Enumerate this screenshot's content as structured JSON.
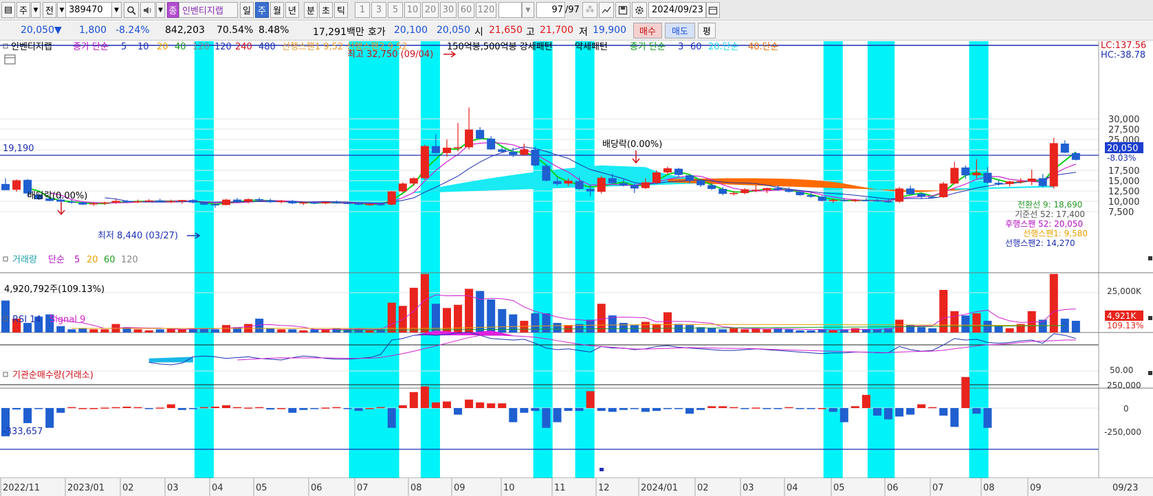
{
  "toolbar": {
    "period_selector": "주",
    "prev_label": "전",
    "code": "389470",
    "stock_name": "인벤티지랩",
    "tf_items": [
      "일",
      "주",
      "월",
      "년",
      "분",
      "초",
      "틱"
    ],
    "tf_selected": "주",
    "count_items": [
      "1",
      "3",
      "5",
      "10",
      "20",
      "30",
      "60",
      "120"
    ],
    "count_value": "97",
    "count_total": "/97",
    "date": "2024/09/23"
  },
  "quote": {
    "price": "20,050",
    "change_arrow": "▼",
    "change": "1,800",
    "change_pct": "-8.24%",
    "volume": "842,203",
    "volume_ratio": "70.54%",
    "turnover": "8.48%",
    "amount": "17,291백만",
    "hoga_label": "호가",
    "ask": "20,100",
    "bid": "20,050",
    "open_label": "시",
    "open": "21,650",
    "high_label": "고",
    "high": "21,700",
    "low_label": "저",
    "low": "19,900",
    "buy_label": "매수",
    "sell_label": "매도",
    "pyeong_label": "평"
  },
  "legend": {
    "name": "인벤티지랩",
    "price_ma_label": "종가 단순",
    "price_ma": [
      "5",
      "10",
      "20",
      "40",
      "120",
      "120",
      "240",
      "480"
    ],
    "ichimoku": "선행스팬1 9,52 선행스팬2 9,52",
    "pattern1": "150억봉,500억봉 강세패턴",
    "pattern2": "약세패턴",
    "ma2_label": "종가 단순",
    "ma2": [
      "3",
      "60",
      "20.단순",
      "40.단순"
    ]
  },
  "annotations": {
    "high": "최고 32,750 (09/04)",
    "low": "최저 8,440 (03/27)",
    "div1": "배당락(0.00%)",
    "div2": "배당락(0.00%)",
    "hline": "19,190"
  },
  "right_labels": {
    "lc": "LC:137.56",
    "hc": "HC:-38.78",
    "last": "20,050",
    "last_pct": "-8.03%",
    "ichi1": "전환선 9: 18,690",
    "ichi2": "기준선 52: 17,400",
    "ichi3": "후행스팬 52: 20,050",
    "ichi4": "선행스팬1: 9,580",
    "ichi5": "선행스팬2: 14,270",
    "price_ticks": [
      "30,000",
      "27,500",
      "25,000",
      "22,500",
      "17,500",
      "15,000",
      "12,500",
      "10,000",
      "7,500"
    ],
    "vol_tick": "25,000K",
    "vol_last": "4,921K",
    "vol_last_pct": "109.13%",
    "rsi_tick": "50.00",
    "inst_ticks": [
      "250,000",
      "0",
      "-250,000"
    ]
  },
  "volume_panel": {
    "label": "거래량",
    "ma_label": "단순",
    "ma": [
      "5",
      "20",
      "60",
      "120"
    ],
    "value": "4,920,792주(109.13%)"
  },
  "rsi_panel": {
    "label": "RSI 14",
    "signal": "Signal 9"
  },
  "inst_panel": {
    "label": "기관순매수량(거래소)",
    "value": "-333,657"
  },
  "xaxis": [
    "2022/11",
    "2023/01",
    "02",
    "03",
    "04",
    "05",
    "06",
    "07",
    "08",
    "09",
    "10",
    "11",
    "12",
    "2024/01",
    "02",
    "03",
    "04",
    "05",
    "06",
    "07",
    "08",
    "09"
  ],
  "xaxis_right": "09/23",
  "colors": {
    "up": "#e8241d",
    "down": "#1f5fd0",
    "highlight": "#00f3f8",
    "cloud_bull": "#19eaf3",
    "cloud_bear": "#ff6a00"
  },
  "chart_data": {
    "type": "candlestick",
    "candles": [
      [
        14200,
        15600,
        13000,
        12700
      ],
      [
        12800,
        15300,
        12300,
        15100
      ],
      [
        15200,
        15400,
        11100,
        11900
      ],
      [
        11600,
        12000,
        10300,
        10500
      ],
      [
        10700,
        11100,
        10000,
        10100
      ],
      [
        10400,
        11300,
        9800,
        9900
      ],
      [
        9900,
        10400,
        9400,
        9700
      ],
      [
        9700,
        10000,
        9100,
        9200
      ],
      [
        9300,
        9800,
        8900,
        9500
      ],
      [
        9500,
        9900,
        9100,
        9700
      ],
      [
        9700,
        10500,
        9400,
        10100
      ],
      [
        10100,
        10300,
        9600,
        9800
      ],
      [
        9800,
        10400,
        9600,
        10000
      ],
      [
        10000,
        10500,
        9800,
        10200
      ],
      [
        10200,
        10600,
        9800,
        9900
      ],
      [
        9900,
        10400,
        9600,
        10000
      ],
      [
        10000,
        10300,
        9400,
        10300
      ],
      [
        10300,
        10500,
        9500,
        9700
      ],
      [
        9700,
        9900,
        9000,
        9200
      ],
      [
        9300,
        9500,
        8440,
        9000
      ],
      [
        9100,
        10600,
        9000,
        10400
      ],
      [
        10400,
        10800,
        9700,
        9900
      ],
      [
        9900,
        10700,
        9500,
        10500
      ],
      [
        10500,
        10900,
        10000,
        10200
      ],
      [
        10200,
        10600,
        9600,
        9800
      ],
      [
        9800,
        10300,
        9500,
        10100
      ],
      [
        10100,
        10300,
        9300,
        9500
      ],
      [
        9500,
        9900,
        9100,
        9700
      ],
      [
        9700,
        9900,
        9300,
        9500
      ],
      [
        9500,
        10000,
        9300,
        9800
      ],
      [
        9800,
        10200,
        9400,
        9600
      ],
      [
        9600,
        9900,
        9300,
        9500
      ],
      [
        9500,
        9700,
        9000,
        9200
      ],
      [
        9200,
        9500,
        8900,
        9300
      ],
      [
        9300,
        9500,
        8900,
        9100
      ],
      [
        9200,
        12500,
        9000,
        12400
      ],
      [
        12400,
        14600,
        12100,
        14300
      ],
      [
        14300,
        15800,
        13700,
        15600
      ],
      [
        15600,
        23700,
        15300,
        23400
      ],
      [
        23400,
        26200,
        21600,
        21700
      ],
      [
        21700,
        25000,
        20800,
        23000
      ],
      [
        23000,
        29000,
        22100,
        23100
      ],
      [
        23100,
        32750,
        22600,
        27400
      ],
      [
        27300,
        28000,
        25000,
        25200
      ],
      [
        25200,
        25800,
        22500,
        22600
      ],
      [
        22600,
        23100,
        21800,
        22000
      ],
      [
        22000,
        23000,
        20700,
        21300
      ],
      [
        21300,
        24000,
        21000,
        22600
      ],
      [
        22500,
        23200,
        18500,
        18700
      ],
      [
        18600,
        19000,
        14800,
        15000
      ],
      [
        14900,
        15900,
        13800,
        14200
      ],
      [
        14300,
        15600,
        13700,
        15000
      ],
      [
        14900,
        15900,
        12800,
        13000
      ],
      [
        13000,
        14000,
        11200,
        12400
      ],
      [
        12300,
        16200,
        11900,
        15700
      ],
      [
        15600,
        16700,
        14200,
        14400
      ],
      [
        14400,
        15300,
        13600,
        13900
      ],
      [
        13900,
        14300,
        12000,
        13100
      ],
      [
        13200,
        15600,
        13000,
        14600
      ],
      [
        14500,
        17500,
        14200,
        17000
      ],
      [
        17000,
        18400,
        16600,
        18000
      ],
      [
        17900,
        18100,
        15900,
        16400
      ],
      [
        16300,
        16500,
        14400,
        15000
      ],
      [
        15000,
        15300,
        13500,
        13900
      ],
      [
        13900,
        14400,
        12700,
        13000
      ],
      [
        13000,
        13500,
        11500,
        11800
      ],
      [
        11800,
        12500,
        11400,
        12000
      ],
      [
        12000,
        13200,
        11700,
        12900
      ],
      [
        12800,
        13800,
        12200,
        12800
      ],
      [
        12700,
        13300,
        12000,
        13200
      ],
      [
        13200,
        13900,
        12500,
        12800
      ],
      [
        12800,
        13400,
        12100,
        12300
      ],
      [
        12300,
        12800,
        11300,
        11500
      ],
      [
        11500,
        12100,
        10800,
        11100
      ],
      [
        11100,
        11400,
        10000,
        10100
      ],
      [
        10100,
        10700,
        9600,
        10300
      ],
      [
        10300,
        10800,
        9900,
        10100
      ],
      [
        10100,
        10600,
        9800,
        10300
      ],
      [
        10300,
        10900,
        10000,
        10200
      ],
      [
        10200,
        10600,
        9900,
        10000
      ],
      [
        10000,
        10500,
        9600,
        9800
      ],
      [
        9900,
        13500,
        9600,
        13100
      ],
      [
        13100,
        13800,
        11600,
        11700
      ],
      [
        11800,
        12100,
        10500,
        11100
      ],
      [
        11100,
        11300,
        10700,
        11000
      ],
      [
        11000,
        14700,
        10800,
        14300
      ],
      [
        14300,
        19600,
        14100,
        18100
      ],
      [
        18200,
        18700,
        15400,
        16300
      ],
      [
        16300,
        20200,
        15500,
        16900
      ],
      [
        16900,
        18300,
        14300,
        14500
      ],
      [
        14500,
        15100,
        13800,
        14200
      ],
      [
        14200,
        15000,
        13600,
        14800
      ],
      [
        14800,
        15600,
        14300,
        14900
      ],
      [
        14800,
        17700,
        13900,
        15500
      ],
      [
        15600,
        16600,
        13400,
        13700
      ],
      [
        13600,
        25400,
        13100,
        24100
      ],
      [
        24000,
        24800,
        21700,
        21800
      ],
      [
        21700,
        21900,
        19900,
        20050
      ]
    ],
    "volume": [
      3000,
      1300,
      900,
      1500,
      1700,
      600,
      300,
      400,
      300,
      300,
      800,
      500,
      300,
      200,
      300,
      400,
      300,
      400,
      400,
      300,
      700,
      500,
      800,
      1300,
      400,
      300,
      300,
      200,
      300,
      300,
      400,
      300,
      300,
      200,
      300,
      2800,
      2500,
      4200,
      5500,
      2700,
      2300,
      2600,
      4100,
      3900,
      3100,
      2200,
      1700,
      1100,
      1800,
      1800,
      900,
      700,
      800,
      1200,
      2700,
      1600,
      900,
      700,
      1000,
      800,
      1900,
      800,
      700,
      500,
      400,
      300,
      400,
      300,
      400,
      300,
      400,
      300,
      200,
      200,
      300,
      200,
      300,
      400,
      300,
      300,
      400,
      1200,
      700,
      500,
      400,
      4000,
      2000,
      1600,
      1800,
      1100,
      600,
      400,
      800,
      2000,
      1200,
      5500,
      1300,
      1100
    ]
  }
}
